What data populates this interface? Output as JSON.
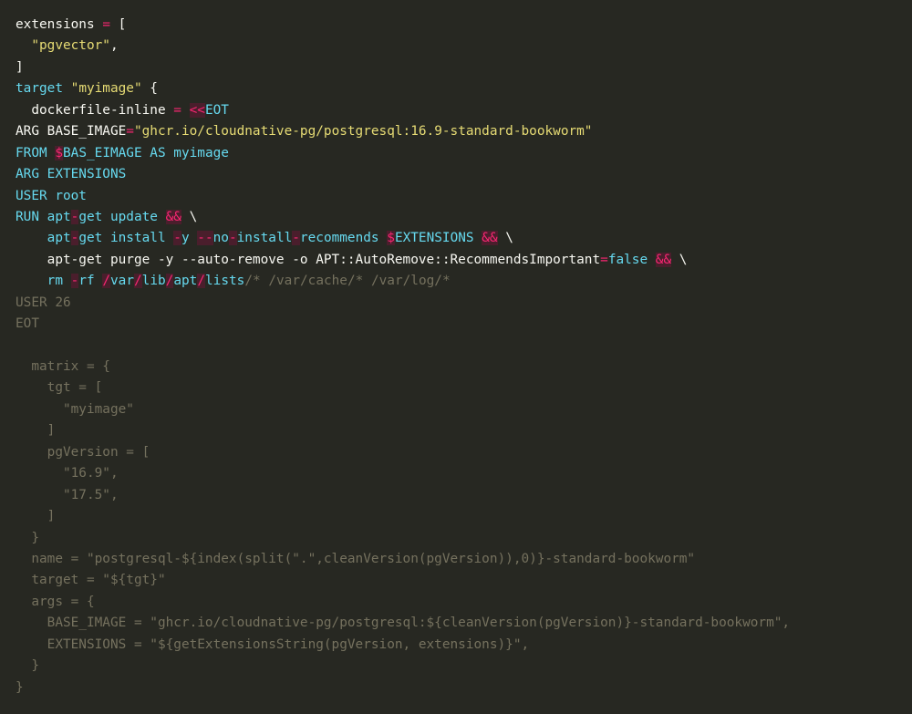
{
  "code": {
    "lines": [
      [
        {
          "t": "extensions ",
          "c": "p"
        },
        {
          "t": "=",
          "c": "o"
        },
        {
          "t": " [",
          "c": "p"
        }
      ],
      [
        {
          "t": "  ",
          "c": "p"
        },
        {
          "t": "\"pgvector\"",
          "c": "s"
        },
        {
          "t": ",",
          "c": "p"
        }
      ],
      [
        {
          "t": "]",
          "c": "p"
        }
      ],
      [
        {
          "t": "target ",
          "c": "k"
        },
        {
          "t": "\"myimage\"",
          "c": "s"
        },
        {
          "t": " {",
          "c": "p"
        }
      ],
      [
        {
          "t": "  dockerfile-inline ",
          "c": "p"
        },
        {
          "t": "=",
          "c": "o"
        },
        {
          "t": " ",
          "c": "p"
        },
        {
          "t": "<<",
          "c": "e"
        },
        {
          "t": "EOT",
          "c": "k"
        }
      ],
      [
        {
          "t": "ARG BASE_IMAGE",
          "c": "p"
        },
        {
          "t": "=",
          "c": "o"
        },
        {
          "t": "\"ghcr.io/cloudnative-pg/postgresql:16.9-standard-bookworm\"",
          "c": "s"
        }
      ],
      [
        {
          "t": "FROM ",
          "c": "k"
        },
        {
          "t": "$",
          "c": "e"
        },
        {
          "t": "BAS_EIMAGE AS myimage",
          "c": "k"
        }
      ],
      [
        {
          "t": "ARG EXTENSIONS",
          "c": "k"
        }
      ],
      [
        {
          "t": "USER root",
          "c": "k"
        }
      ],
      [
        {
          "t": "RUN apt",
          "c": "k"
        },
        {
          "t": "-",
          "c": "e"
        },
        {
          "t": "get update ",
          "c": "k"
        },
        {
          "t": "&&",
          "c": "e"
        },
        {
          "t": " \\",
          "c": "p"
        }
      ],
      [
        {
          "t": "    apt",
          "c": "k"
        },
        {
          "t": "-",
          "c": "e"
        },
        {
          "t": "get install ",
          "c": "k"
        },
        {
          "t": "-",
          "c": "e"
        },
        {
          "t": "y ",
          "c": "k"
        },
        {
          "t": "--",
          "c": "e"
        },
        {
          "t": "no",
          "c": "k"
        },
        {
          "t": "-",
          "c": "e"
        },
        {
          "t": "install",
          "c": "k"
        },
        {
          "t": "-",
          "c": "e"
        },
        {
          "t": "recommends ",
          "c": "k"
        },
        {
          "t": "$",
          "c": "e"
        },
        {
          "t": "EXTENSIONS ",
          "c": "k"
        },
        {
          "t": "&&",
          "c": "e"
        },
        {
          "t": " \\",
          "c": "p"
        }
      ],
      [
        {
          "t": "    apt-get purge -y --auto-remove -o APT::AutoRemove::RecommendsImportant",
          "c": "p"
        },
        {
          "t": "=",
          "c": "o"
        },
        {
          "t": "false ",
          "c": "k"
        },
        {
          "t": "&&",
          "c": "e"
        },
        {
          "t": " \\",
          "c": "p"
        }
      ],
      [
        {
          "t": "    rm ",
          "c": "k"
        },
        {
          "t": "-",
          "c": "e"
        },
        {
          "t": "rf ",
          "c": "k"
        },
        {
          "t": "/",
          "c": "e"
        },
        {
          "t": "var",
          "c": "k"
        },
        {
          "t": "/",
          "c": "e"
        },
        {
          "t": "lib",
          "c": "k"
        },
        {
          "t": "/",
          "c": "e"
        },
        {
          "t": "apt",
          "c": "k"
        },
        {
          "t": "/",
          "c": "e"
        },
        {
          "t": "lists",
          "c": "k"
        },
        {
          "t": "/* /var/cache/* /var/log/*",
          "c": "c"
        }
      ],
      [
        {
          "t": "USER 26",
          "c": "c"
        }
      ],
      [
        {
          "t": "EOT",
          "c": "c"
        }
      ],
      [
        {
          "t": "",
          "c": "c"
        }
      ],
      [
        {
          "t": "  matrix = {",
          "c": "c"
        }
      ],
      [
        {
          "t": "    tgt = [",
          "c": "c"
        }
      ],
      [
        {
          "t": "      \"myimage\"",
          "c": "c"
        }
      ],
      [
        {
          "t": "    ]",
          "c": "c"
        }
      ],
      [
        {
          "t": "    pgVersion = [",
          "c": "c"
        }
      ],
      [
        {
          "t": "      \"16.9\",",
          "c": "c"
        }
      ],
      [
        {
          "t": "      \"17.5\",",
          "c": "c"
        }
      ],
      [
        {
          "t": "    ]",
          "c": "c"
        }
      ],
      [
        {
          "t": "  }",
          "c": "c"
        }
      ],
      [
        {
          "t": "  name = \"postgresql-${index(split(\".\",cleanVersion(pgVersion)),0)}-standard-bookworm\"",
          "c": "c"
        }
      ],
      [
        {
          "t": "  target = \"${tgt}\"",
          "c": "c"
        }
      ],
      [
        {
          "t": "  args = {",
          "c": "c"
        }
      ],
      [
        {
          "t": "    BASE_IMAGE = \"ghcr.io/cloudnative-pg/postgresql:${cleanVersion(pgVersion)}-standard-bookworm\",",
          "c": "c"
        }
      ],
      [
        {
          "t": "    EXTENSIONS = \"${getExtensionsString(pgVersion, extensions)}\",",
          "c": "c"
        }
      ],
      [
        {
          "t": "  }",
          "c": "c"
        }
      ],
      [
        {
          "t": "}",
          "c": "c"
        }
      ]
    ]
  }
}
